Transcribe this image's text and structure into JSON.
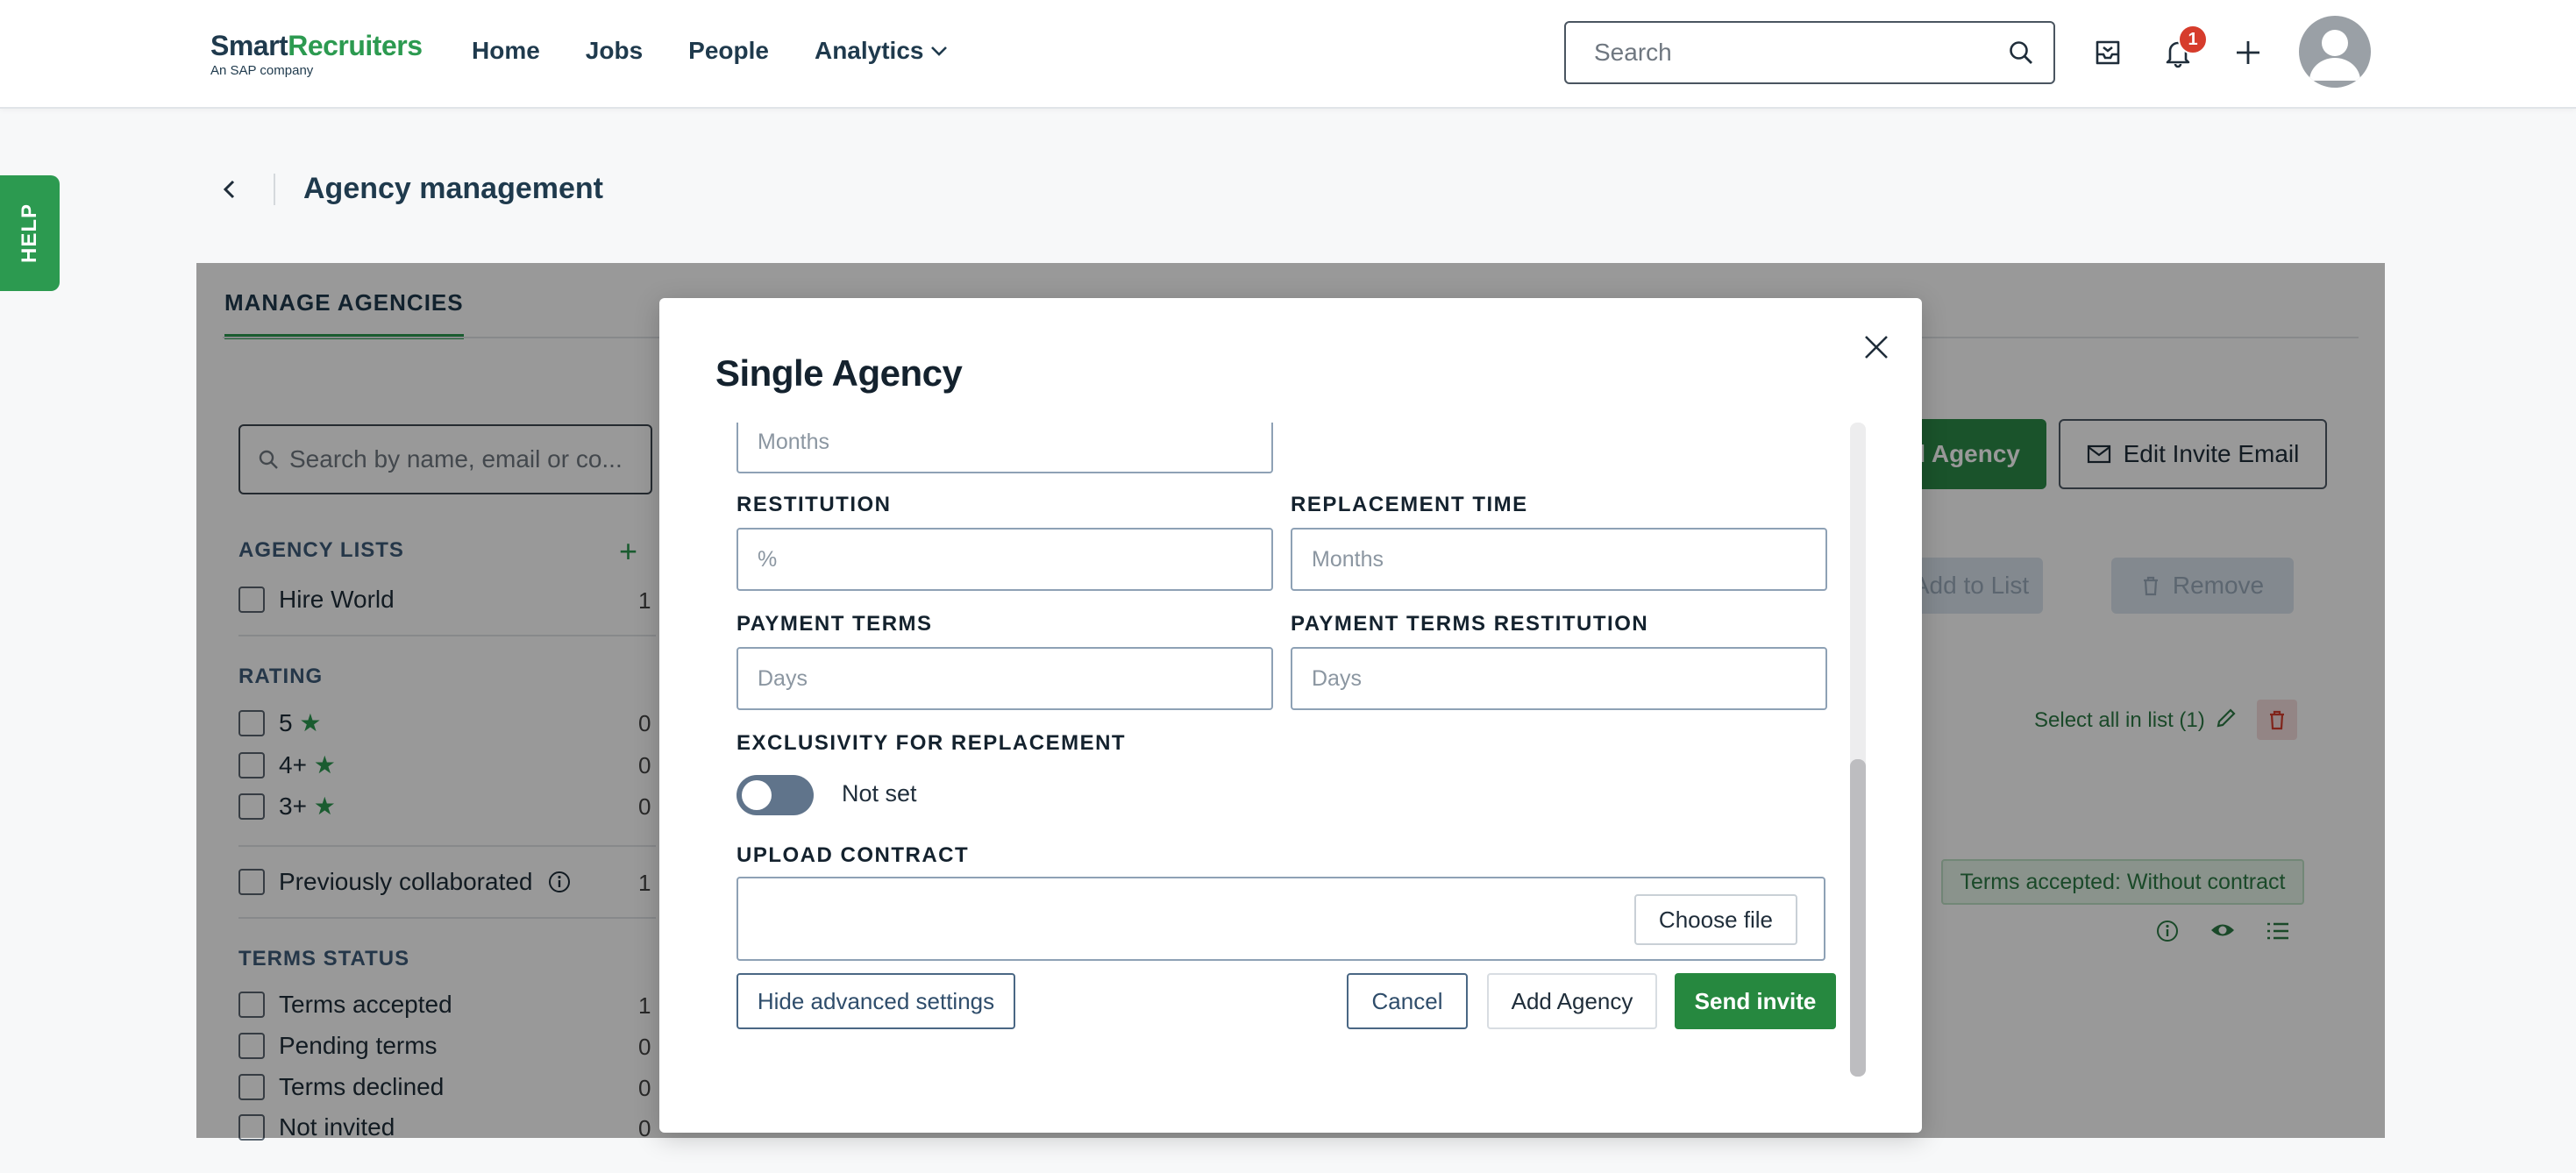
{
  "app": {
    "logo_main_dark": "Smart",
    "logo_main_accent": "Recruiters",
    "logo_sub": "An SAP company"
  },
  "nav": {
    "items": [
      {
        "label": "Home"
      },
      {
        "label": "Jobs"
      },
      {
        "label": "People"
      },
      {
        "label": "Analytics"
      }
    ],
    "search_placeholder": "Search",
    "notification_count": "1"
  },
  "help": {
    "label": "HELP"
  },
  "page": {
    "title": "Agency management"
  },
  "background": {
    "tab_label": "MANAGE AGENCIES",
    "search_placeholder": "Search by name, email or co...",
    "agency_lists_title": "AGENCY LISTS",
    "agency_lists": [
      {
        "label": "Hire World",
        "count": "1"
      }
    ],
    "rating_title": "RATING",
    "ratings": [
      {
        "label": "5",
        "count": "0"
      },
      {
        "label": "4+",
        "count": "0"
      },
      {
        "label": "3+",
        "count": "0"
      }
    ],
    "previously_collaborated": {
      "label": "Previously collaborated",
      "count": "1"
    },
    "terms_status_title": "TERMS STATUS",
    "terms_status": [
      {
        "label": "Terms accepted",
        "count": "1"
      },
      {
        "label": "Pending terms",
        "count": "0"
      },
      {
        "label": "Terms declined",
        "count": "0"
      },
      {
        "label": "Not invited",
        "count": "0"
      }
    ],
    "add_agency_partial": "d Agency",
    "edit_invite_email": "Edit Invite Email",
    "add_to_list": "Add to List",
    "remove": "Remove",
    "select_all": "Select all in list (1)",
    "terms_pill": "Terms accepted: Without contract"
  },
  "modal": {
    "title": "Single Agency",
    "top_field_placeholder": "Months",
    "restitution": {
      "label": "RESTITUTION",
      "placeholder": "%"
    },
    "replacement_time": {
      "label": "REPLACEMENT TIME",
      "placeholder": "Months"
    },
    "payment_terms": {
      "label": "PAYMENT TERMS",
      "placeholder": "Days"
    },
    "payment_terms_restitution": {
      "label": "PAYMENT TERMS RESTITUTION",
      "placeholder": "Days"
    },
    "exclusivity": {
      "label": "EXCLUSIVITY FOR REPLACEMENT",
      "value_label": "Not set"
    },
    "upload_contract": {
      "label": "UPLOAD CONTRACT",
      "button": "Choose file"
    },
    "hide_advanced": "Hide advanced settings",
    "cancel": "Cancel",
    "add_agency": "Add Agency",
    "send_invite": "Send invite"
  },
  "colors": {
    "brand_green": "#2c9a50",
    "primary_button": "#26883f",
    "notification_badge": "#d63c2c",
    "toggle_off": "#60748b"
  }
}
